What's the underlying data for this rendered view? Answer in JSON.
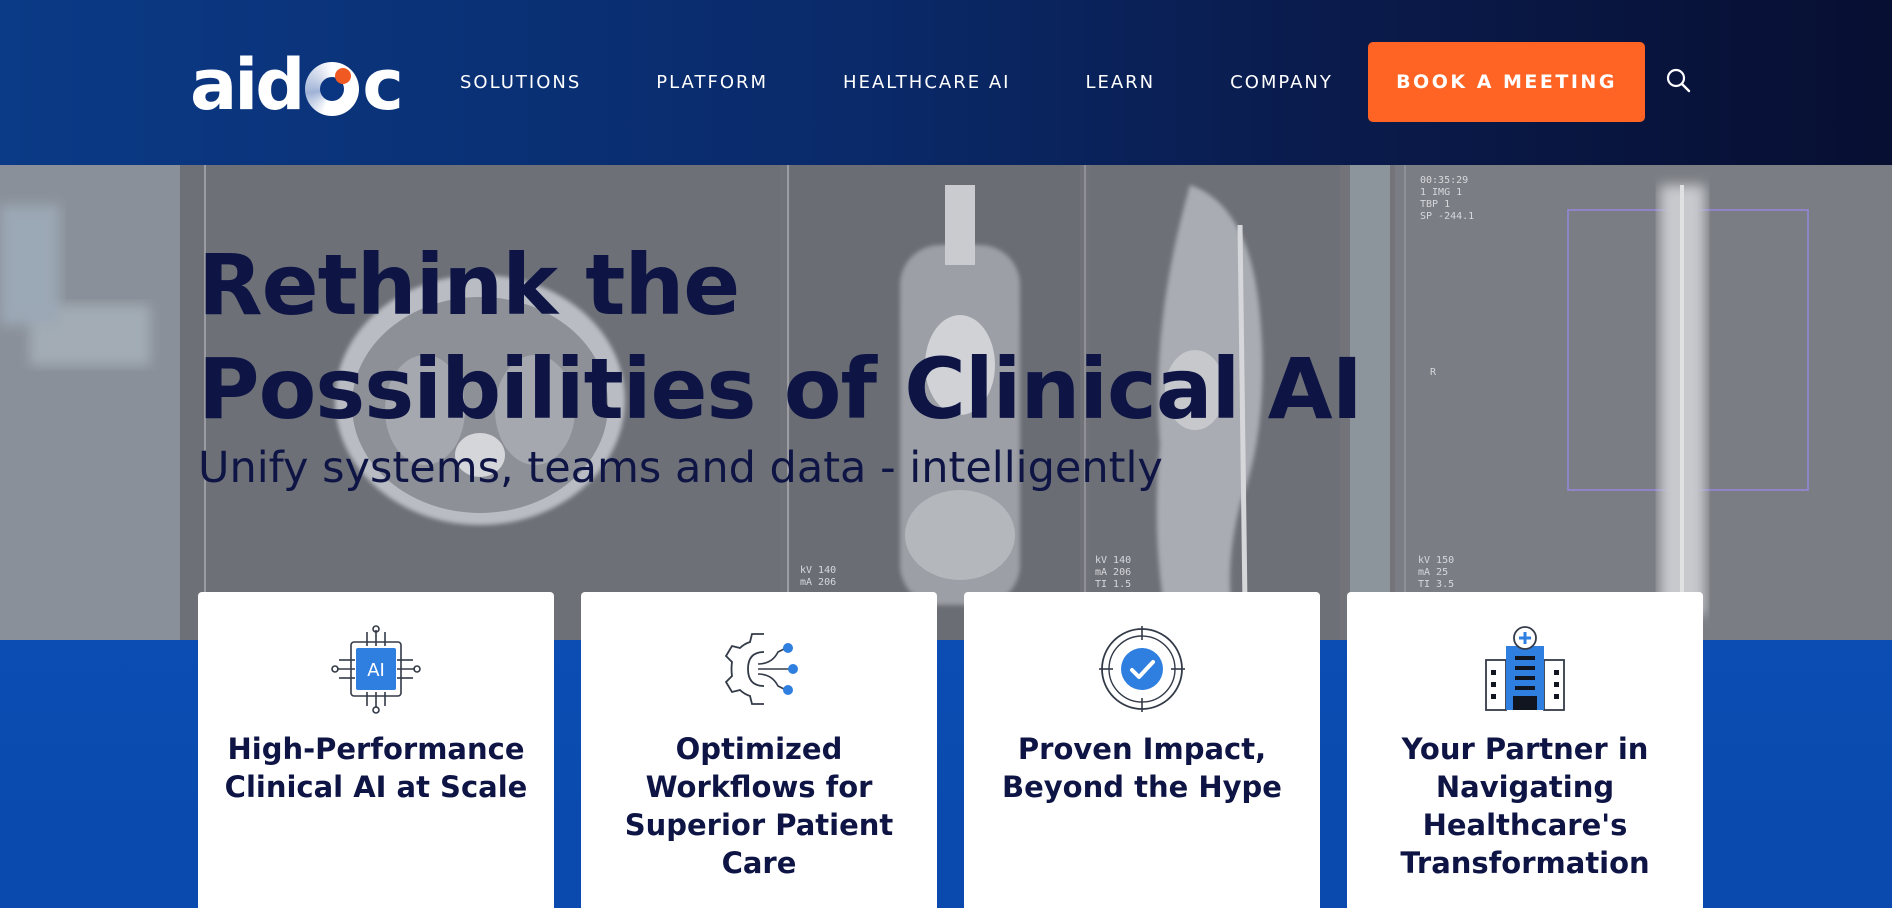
{
  "header": {
    "logo": "aidoc",
    "nav": [
      "SOLUTIONS",
      "PLATFORM",
      "HEALTHCARE AI",
      "LEARN",
      "COMPANY"
    ],
    "cta_label": "BOOK A MEETING",
    "icons": {
      "search": "search-icon"
    }
  },
  "hero": {
    "title_line1": "Rethink the",
    "title_line2": "Possibilities of Clinical AI",
    "subtitle": "Unify systems, teams and data - intelligently"
  },
  "features": [
    {
      "icon": "ai-chip-icon",
      "title": "High-Performance Clinical AI at Scale"
    },
    {
      "icon": "workflow-gear-icon",
      "title": "Optimized Workflows for Superior Patient Care"
    },
    {
      "icon": "target-check-icon",
      "title": "Proven Impact, Beyond the Hype"
    },
    {
      "icon": "hospital-icon",
      "title": "Your Partner in Navigating Healthcare's Transformation"
    }
  ],
  "colors": {
    "header_bg": "#0a2a6a",
    "cta": "#ff6425",
    "logo_dot": "#f05a22",
    "text_dark": "#0e1545",
    "section_blue": "#0b4db3",
    "icon_blue": "#2f7fe0"
  }
}
